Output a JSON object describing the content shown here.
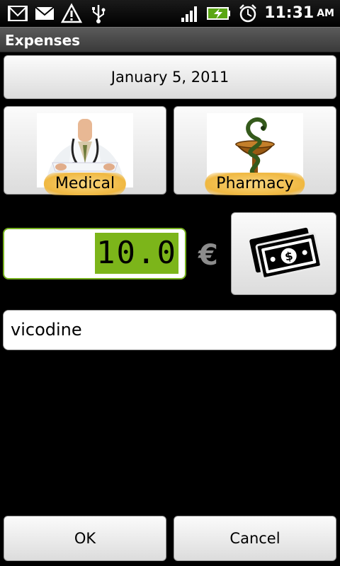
{
  "status_bar": {
    "icons": [
      "gmail-icon",
      "mail-icon",
      "warning-icon",
      "usb-icon",
      "signal-icon",
      "battery-charging-icon",
      "alarm-icon"
    ],
    "time": "11:31",
    "ampm": "AM"
  },
  "title_bar": {
    "title": "Expenses"
  },
  "date": {
    "label": "January 5, 2011"
  },
  "categories": [
    {
      "label": "Medical",
      "icon": "doctor-icon"
    },
    {
      "label": "Pharmacy",
      "icon": "pharmacy-bowl-icon"
    }
  ],
  "amount": {
    "value": "10.0",
    "currency": "€"
  },
  "note": {
    "value": "vicodine"
  },
  "actions": {
    "ok": "OK",
    "cancel": "Cancel"
  },
  "colors": {
    "highlight": "#7cb51a",
    "focus_border": "#76b01e",
    "badge": "#f0b841"
  }
}
